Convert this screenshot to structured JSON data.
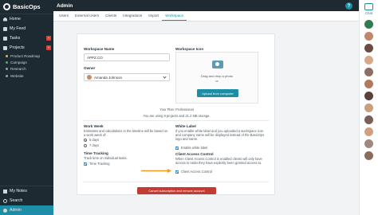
{
  "app": {
    "name": "BasicOps"
  },
  "sidebar": {
    "items": [
      {
        "label": "Home",
        "icon": "home-icon"
      },
      {
        "label": "My Feed",
        "icon": "feed-icon"
      },
      {
        "label": "Tasks",
        "icon": "tasks-icon",
        "badge": "+"
      },
      {
        "label": "Projects",
        "icon": "projects-icon",
        "badge": "+"
      }
    ],
    "projects": [
      {
        "label": "Product Roadmap",
        "color": "#e8b23a"
      },
      {
        "label": "Campaign",
        "color": "#4caf50"
      },
      {
        "label": "Research",
        "color": "#9e9e9e"
      },
      {
        "label": "Website",
        "color": "#9e9e9e"
      }
    ],
    "bottom": [
      {
        "label": "My Notes",
        "icon": "notes-icon"
      },
      {
        "label": "Search",
        "icon": "search-icon"
      },
      {
        "label": "Admin",
        "icon": "admin-icon"
      }
    ]
  },
  "header": {
    "title": "Admin",
    "help": "?"
  },
  "tabs": [
    "Users",
    "External Users",
    "Clients",
    "Integrations",
    "Import",
    "Workspace"
  ],
  "chat": {
    "label": "Chat"
  },
  "workspace": {
    "name_label": "Workspace Name",
    "name_value": "APPZ.CO",
    "owner_label": "Owner",
    "owner_value": "Amanda Johnson",
    "icon_label": "Workspace Icon",
    "dropzone_text": "Drag and drop a photo",
    "dropzone_or": "or",
    "upload_label": "Upload from computer",
    "plan_text": "Your Plan: Professional",
    "usage_text": "You are using 8 projects and 21.2 MB storage."
  },
  "work_week": {
    "title": "Work Week",
    "description": "Estimates and calculations in the timeline will be based on a work week of:",
    "option1": "5 days",
    "option2": "7 days"
  },
  "time_tracking": {
    "title": "Time Tracking",
    "description": "Track time on individual tasks.",
    "checkbox_label": "Time Tracking"
  },
  "white_label": {
    "title": "White Label",
    "description": "If you enable white label and you uploaded a workspace icon and company name will be displayed instead of the BasicOps logo and name.",
    "checkbox_label": "Enable white label"
  },
  "client_access": {
    "title": "Client Access Control",
    "description": "When Client Access Control is enabled clients will only have access to tasks they have explicitly been granted access to.",
    "checkbox_label": "Client Access Control"
  },
  "cancel_label": "Cancel subscription and remove account",
  "colors": {
    "accent": "#1d8ea6",
    "sidebar": "#1e2a32",
    "danger": "#c43b33",
    "arrow": "#f39a1e"
  }
}
